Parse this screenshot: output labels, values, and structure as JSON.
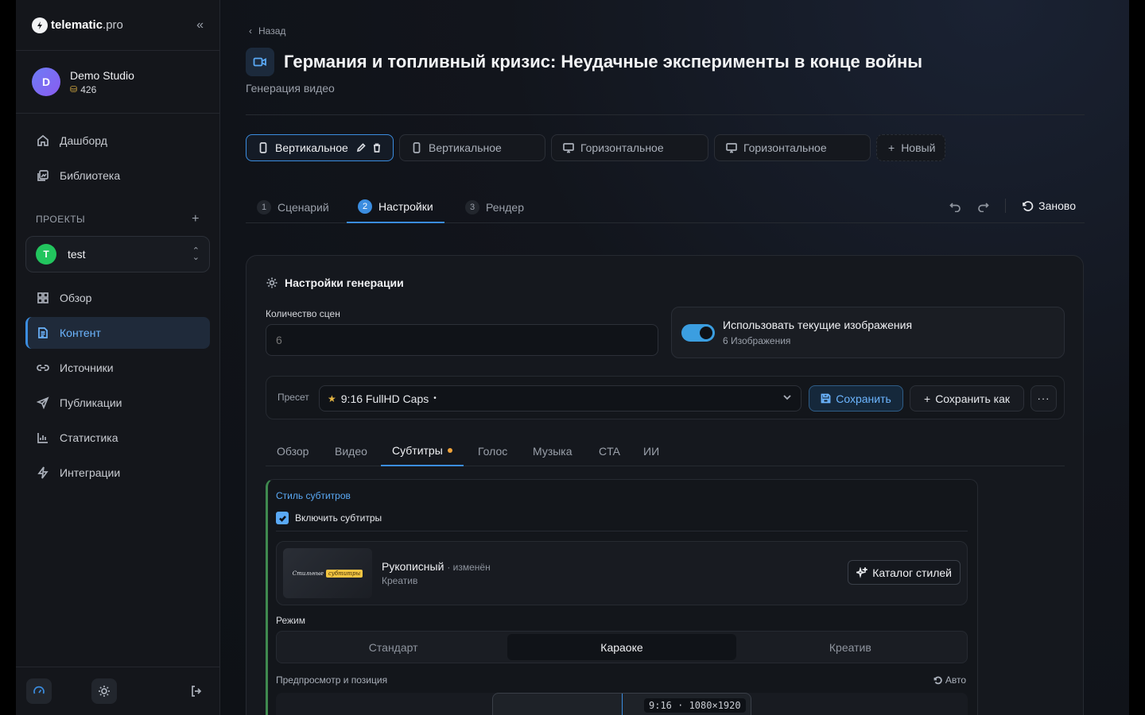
{
  "brand": {
    "name_bold": "telematic",
    "name_light": ".pro"
  },
  "account": {
    "initial": "D",
    "name": "Demo Studio",
    "credits": "426"
  },
  "nav_top": [
    {
      "label": "Дашборд",
      "icon": "home-icon"
    },
    {
      "label": "Библиотека",
      "icon": "library-icon"
    }
  ],
  "projects": {
    "section_label": "ПРОЕКТЫ",
    "current": {
      "initial": "T",
      "name": "test"
    }
  },
  "nav_project": [
    {
      "label": "Обзор",
      "icon": "grid-icon"
    },
    {
      "label": "Контент",
      "icon": "document-icon",
      "active": true
    },
    {
      "label": "Источники",
      "icon": "link-icon"
    },
    {
      "label": "Публикации",
      "icon": "send-icon"
    },
    {
      "label": "Статистика",
      "icon": "chart-icon"
    },
    {
      "label": "Интеграции",
      "icon": "lightning-icon"
    }
  ],
  "page": {
    "back_label": "Назад",
    "title": "Германия и топливный кризис: Неудачные эксперименты в конце войны",
    "subtitle": "Генерация видео"
  },
  "version_tabs": [
    {
      "label": "Вертикальное",
      "orientation": "vertical",
      "active": true
    },
    {
      "label": "Вертикальное",
      "orientation": "vertical"
    },
    {
      "label": "Горизонтальное",
      "orientation": "horizontal"
    },
    {
      "label": "Горизонтальное",
      "orientation": "horizontal"
    },
    {
      "label": "Новый",
      "orientation": "new"
    }
  ],
  "steps": [
    {
      "num": "1",
      "label": "Сценарий"
    },
    {
      "num": "2",
      "label": "Настройки",
      "active": true
    },
    {
      "num": "3",
      "label": "Рендер"
    }
  ],
  "restart_label": "Заново",
  "settings": {
    "heading": "Настройки генерации",
    "scene_count_label": "Количество сцен",
    "scene_count_value": "6",
    "use_images": {
      "title": "Использовать текущие изображения",
      "sub": "6 Изображения",
      "enabled": true
    },
    "preset": {
      "label": "Пресет",
      "value": "9:16 FullHD Caps",
      "modified_dot": "•",
      "save_label": "Сохранить",
      "save_as_label": "Сохранить как",
      "more_label": "···"
    },
    "sub_tabs": [
      {
        "label": "Обзор"
      },
      {
        "label": "Видео"
      },
      {
        "label": "Субтитры",
        "active": true,
        "dot": true
      },
      {
        "label": "Голос"
      },
      {
        "label": "Музыка"
      },
      {
        "label": "CTA"
      },
      {
        "label": "ИИ"
      }
    ],
    "subtitles": {
      "section_label": "Стиль субтитров",
      "enable_label": "Включить субтитры",
      "enabled": true,
      "style": {
        "name": "Рукописный",
        "modified": "· изменён",
        "category": "Креатив",
        "thumb_word1": "Стильные",
        "thumb_word2": "субтитры"
      },
      "catalog_label": "Каталог стилей",
      "mode_label": "Режим",
      "modes": [
        {
          "label": "Стандарт"
        },
        {
          "label": "Караоке",
          "active": true
        },
        {
          "label": "Креатив"
        }
      ],
      "preview_label": "Предпросмотр и позиция",
      "auto_label": "Авто",
      "resolution_badge": "9:16 · 1080×1920"
    }
  },
  "colors": {
    "accent": "#3b8de0",
    "accent_text": "#6cb5ff",
    "success": "#22c55e",
    "warning": "#f0a33a"
  }
}
